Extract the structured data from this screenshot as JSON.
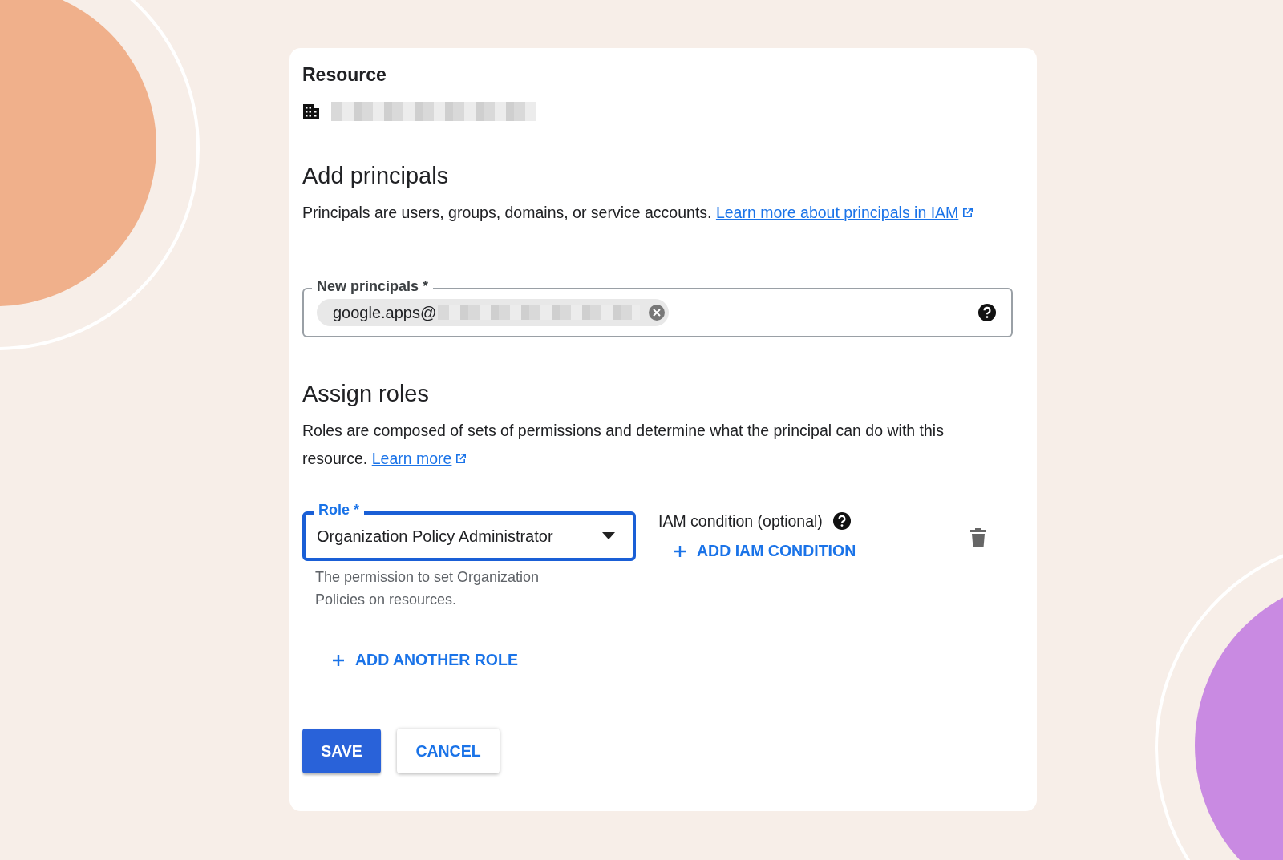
{
  "resource": {
    "title": "Resource"
  },
  "add_principals": {
    "heading": "Add principals",
    "description": "Principals are users, groups, domains, or service accounts.",
    "link": "Learn more about principals in IAM",
    "field": {
      "label": "New principals *",
      "chips": [
        {
          "text": "google.apps@"
        }
      ]
    }
  },
  "assign_roles": {
    "heading": "Assign roles",
    "description": "Roles are composed of sets of permissions and determine what the principal can do with this resource.",
    "link": "Learn more",
    "role_field": {
      "label": "Role *",
      "value": "Organization Policy Administrator",
      "focused": true,
      "hint": "The permission to set Organization Policies on resources."
    },
    "condition": {
      "label": "IAM condition (optional)",
      "button": "ADD IAM CONDITION"
    },
    "add_role_button": "ADD ANOTHER ROLE"
  },
  "buttons": [
    {
      "label": "SAVE",
      "kind": "primary"
    },
    {
      "label": "CANCEL",
      "kind": "secondary"
    }
  ]
}
